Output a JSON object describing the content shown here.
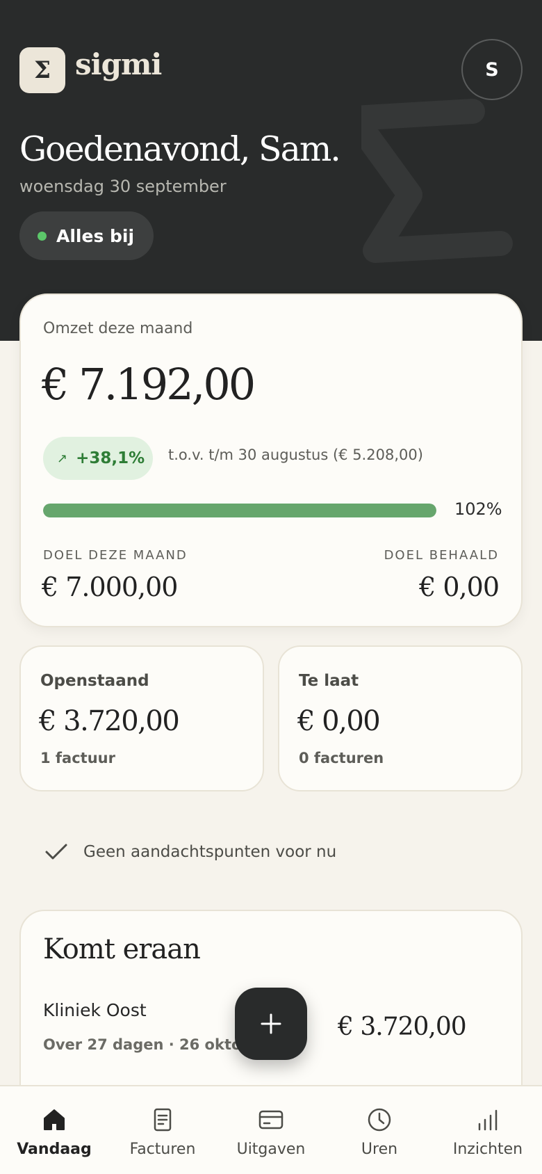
{
  "header": {
    "logo_symbol": "Σ",
    "app_name": "sigmi",
    "avatar_initial": "S",
    "greeting": "Goedenavond, Sam.",
    "date": "woensdag 30 september",
    "status": "Alles bij"
  },
  "revenue": {
    "label": "Omzet deze maand",
    "amount": "€ 7.192,00",
    "change": "+38,1%",
    "comparison": "t.o.v. t/m 30 augustus (€ 5.208,00)",
    "progress_percent": 102,
    "progress_label": "102%",
    "goal_label": "DOEL DEZE MAAND",
    "goal_amount": "€ 7.000,00",
    "achieved_label": "DOEL BEHAALD",
    "achieved_amount": "€ 0,00"
  },
  "outstanding": {
    "title": "Openstaand",
    "amount": "€ 3.720,00",
    "sub": "1 factuur"
  },
  "overdue": {
    "title": "Te laat",
    "amount": "€ 0,00",
    "sub": "0 facturen"
  },
  "attention": {
    "text": "Geen aandachtspunten voor nu"
  },
  "upcoming": {
    "title": "Komt eraan",
    "client": "Kliniek Oost",
    "when": "Over 27 dagen · 26 oktober",
    "amount": "€ 3.720,00"
  },
  "nav": {
    "items": [
      {
        "label": "Vandaag",
        "icon": "home-icon",
        "active": true
      },
      {
        "label": "Facturen",
        "icon": "invoice-icon",
        "active": false
      },
      {
        "label": "Uitgaven",
        "icon": "card-icon",
        "active": false
      },
      {
        "label": "Uren",
        "icon": "clock-icon",
        "active": false
      },
      {
        "label": "Inzichten",
        "icon": "bar-chart-icon",
        "active": false
      }
    ]
  },
  "colors": {
    "header_bg": "#292b2b",
    "page_bg": "#f6f3ec",
    "accent_green": "#66a66d",
    "positive_text": "#2e7d36"
  }
}
